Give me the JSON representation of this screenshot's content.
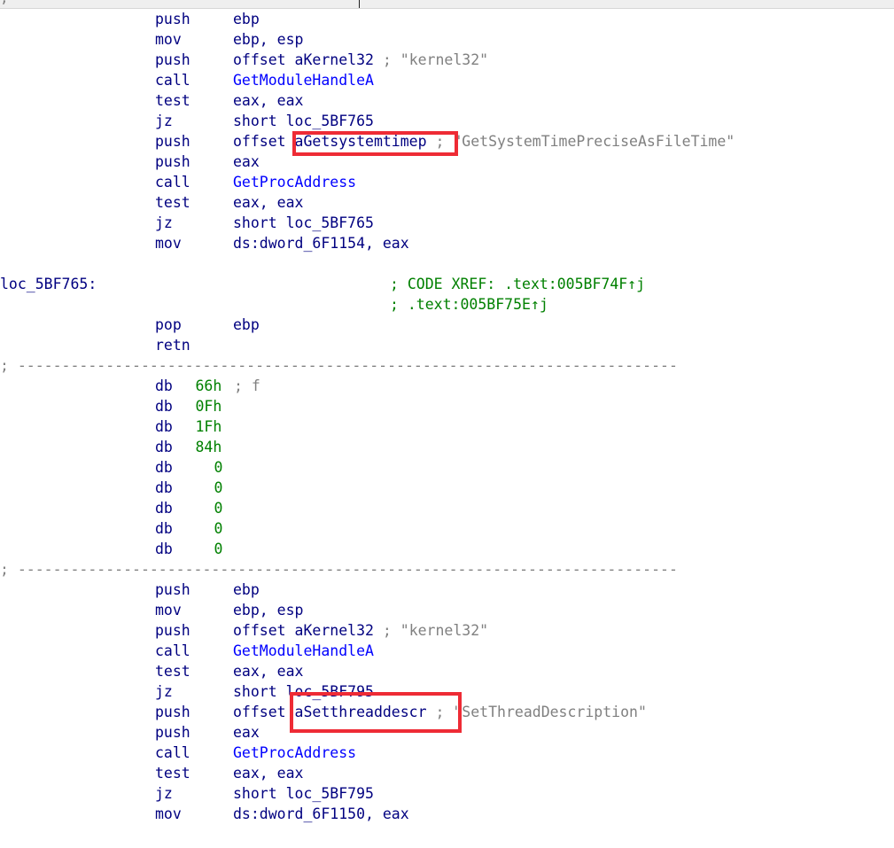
{
  "topbar": {
    "semicolon": ";"
  },
  "block1": [
    {
      "mnemonic": "push",
      "operand": "ebp"
    },
    {
      "mnemonic": "mov",
      "operand": "ebp, esp"
    },
    {
      "mnemonic": "push",
      "operand": "offset aKernel32",
      "comment": "; \"kernel32\""
    },
    {
      "mnemonic": "call",
      "operand": "GetModuleHandleA",
      "api": true
    },
    {
      "mnemonic": "test",
      "operand": "eax, eax"
    },
    {
      "mnemonic": "jz",
      "operand": "short loc_5BF765"
    },
    {
      "mnemonic": "push",
      "operand": "offset aGetsystemtimep",
      "comment": "; \"GetSystemTimePreciseAsFileTime\""
    },
    {
      "mnemonic": "push",
      "operand": "eax"
    },
    {
      "mnemonic": "call",
      "operand": "GetProcAddress",
      "api": true
    },
    {
      "mnemonic": "test",
      "operand": "eax, eax"
    },
    {
      "mnemonic": "jz",
      "operand": "short loc_5BF765"
    },
    {
      "mnemonic": "mov",
      "operand": "ds:dword_6F1154, eax"
    }
  ],
  "label1": {
    "name": "loc_5BF765:",
    "xref1": "; CODE XREF: .text:005BF74F↑j",
    "xref2": "; .text:005BF75E↑j"
  },
  "block2": [
    {
      "mnemonic": "pop",
      "operand": "ebp"
    },
    {
      "mnemonic": "retn",
      "operand": ""
    }
  ],
  "separator": "; ---------------------------------------------------------------------------",
  "db_lines": [
    {
      "mnemonic": "db",
      "value": "66h",
      "comment": "; f"
    },
    {
      "mnemonic": "db",
      "value": "0Fh"
    },
    {
      "mnemonic": "db",
      "value": "1Fh"
    },
    {
      "mnemonic": "db",
      "value": "84h"
    },
    {
      "mnemonic": "db",
      "value": "0"
    },
    {
      "mnemonic": "db",
      "value": "0"
    },
    {
      "mnemonic": "db",
      "value": "0"
    },
    {
      "mnemonic": "db",
      "value": "0"
    },
    {
      "mnemonic": "db",
      "value": "0"
    }
  ],
  "block3": [
    {
      "mnemonic": "push",
      "operand": "ebp"
    },
    {
      "mnemonic": "mov",
      "operand": "ebp, esp"
    },
    {
      "mnemonic": "push",
      "operand": "offset aKernel32",
      "comment": "; \"kernel32\""
    },
    {
      "mnemonic": "call",
      "operand": "GetModuleHandleA",
      "api": true
    },
    {
      "mnemonic": "test",
      "operand": "eax, eax"
    },
    {
      "mnemonic": "jz",
      "operand": "short loc_5BF795"
    },
    {
      "mnemonic": "push",
      "operand": "offset aSetthreaddescr",
      "comment": "; \"SetThreadDescription\""
    },
    {
      "mnemonic": "push",
      "operand": "eax"
    },
    {
      "mnemonic": "call",
      "operand": "GetProcAddress",
      "api": true
    },
    {
      "mnemonic": "test",
      "operand": "eax, eax"
    },
    {
      "mnemonic": "jz",
      "operand": "short loc_5BF795"
    },
    {
      "mnemonic": "mov",
      "operand": "ds:dword_6F1150, eax"
    }
  ],
  "highlight_color": "#ee2b35"
}
